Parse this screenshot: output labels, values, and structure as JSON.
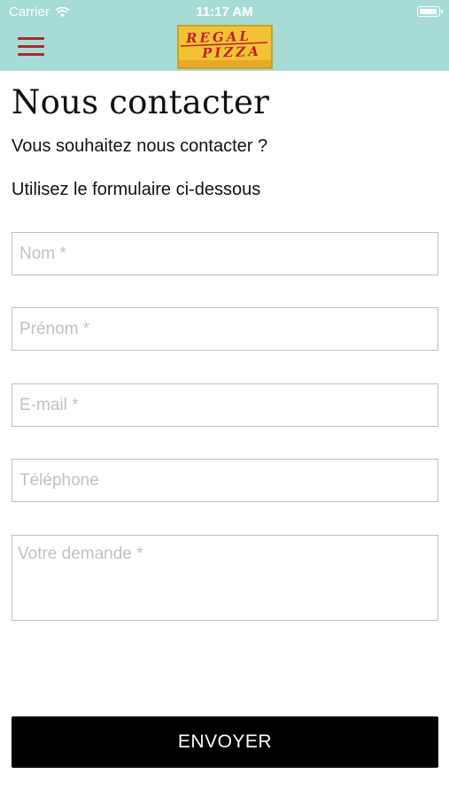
{
  "status_bar": {
    "carrier": "Carrier",
    "time": "11:17 AM",
    "wifi_icon": "wifi-icon",
    "battery_icon": "battery-icon"
  },
  "header": {
    "menu_icon": "hamburger-menu-icon",
    "logo": {
      "line1": "REGAL",
      "line2": "PIZZA"
    },
    "colors": {
      "background": "#a6dcd5",
      "menu": "#b3262c"
    }
  },
  "page": {
    "title": "Nous contacter",
    "intro_1": "Vous souhaitez nous contacter ?",
    "intro_2": "Utilisez le formulaire ci-dessous"
  },
  "form": {
    "nom": {
      "placeholder": "Nom *",
      "value": ""
    },
    "prenom": {
      "placeholder": "Prénom *",
      "value": ""
    },
    "email": {
      "placeholder": "E-mail *",
      "value": ""
    },
    "telephone": {
      "placeholder": "Téléphone",
      "value": ""
    },
    "demande": {
      "placeholder": "Votre demande *",
      "value": ""
    },
    "submit_label": "ENVOYER"
  }
}
